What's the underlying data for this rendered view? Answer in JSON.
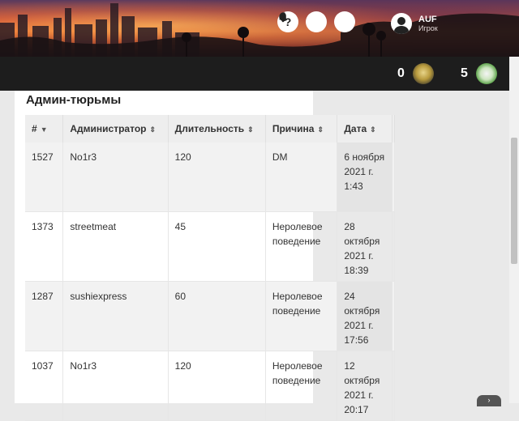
{
  "header": {
    "help_icon": "help-icon",
    "theme_icon": "moon-icon",
    "notify_icon": "bell-icon",
    "user": {
      "name": "AUF",
      "role": "Игрок"
    }
  },
  "stats": [
    {
      "value": "0",
      "icon": "rank-badge-icon"
    },
    {
      "value": "5",
      "icon": "character-badge-icon"
    }
  ],
  "section": {
    "title": "Админ-тюрьмы"
  },
  "table": {
    "headers": [
      "#",
      "Администратор",
      "Длительность",
      "Причина",
      "Дата"
    ],
    "rows": [
      {
        "id": "1527",
        "admin": "No1r3",
        "duration": "120",
        "reason": "DM",
        "date": "6 ноября 2021 г. 1:43"
      },
      {
        "id": "1373",
        "admin": "streetmeat",
        "duration": "45",
        "reason": "Неролевое поведение",
        "date": "28 октября 2021 г. 18:39"
      },
      {
        "id": "1287",
        "admin": "sushiexpress",
        "duration": "60",
        "reason": "Неролевое поведение",
        "date": "24 октября 2021 г. 17:56"
      },
      {
        "id": "1037",
        "admin": "No1r3",
        "duration": "120",
        "reason": "Неролевое поведение",
        "date": "12 октября 2021 г. 20:17"
      }
    ]
  },
  "colors": {
    "topbar": "#1d1d1d",
    "page_bg": "#e9e9e9"
  }
}
